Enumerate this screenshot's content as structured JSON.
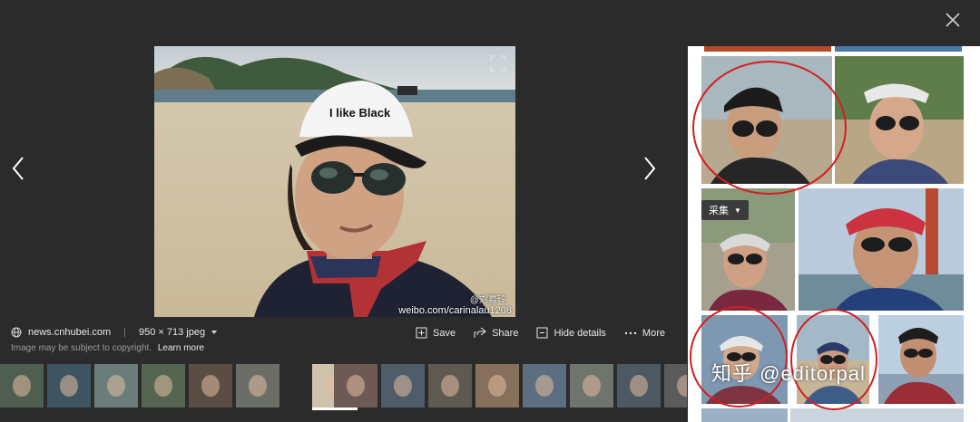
{
  "source": {
    "domain": "news.cnhubei.com",
    "dimensions": "950 × 713 jpeg",
    "copyright_note": "Image may be subject to copyright.",
    "learn_more": "Learn more"
  },
  "actions": {
    "save": "Save",
    "share": "Share",
    "hide_details": "Hide details",
    "more": "More"
  },
  "photo": {
    "cap_text": "I like Black",
    "watermark_url": "weibo.com/carinalau1208",
    "watermark_handle": "@刘嘉玲"
  },
  "related": {
    "collect_label": "采集",
    "overlay_watermark": "知乎 @editorpal"
  },
  "icons": {
    "close": "close-icon",
    "prev": "chevron-left-icon",
    "next": "chevron-right-icon",
    "globe": "globe-icon",
    "dropdown": "caret-down-icon",
    "save": "save-icon",
    "share": "share-icon",
    "hide_details": "hide-details-icon",
    "more": "more-dots-icon"
  },
  "colors": {
    "background": "#2b2b2b",
    "panel": "#ffffff",
    "annotation_circle": "#d21f1f",
    "text_primary": "#e8e8e8",
    "text_secondary": "#9a9a9a"
  },
  "filmstrip": {
    "selected_index": 6,
    "thumb_count": 15
  }
}
